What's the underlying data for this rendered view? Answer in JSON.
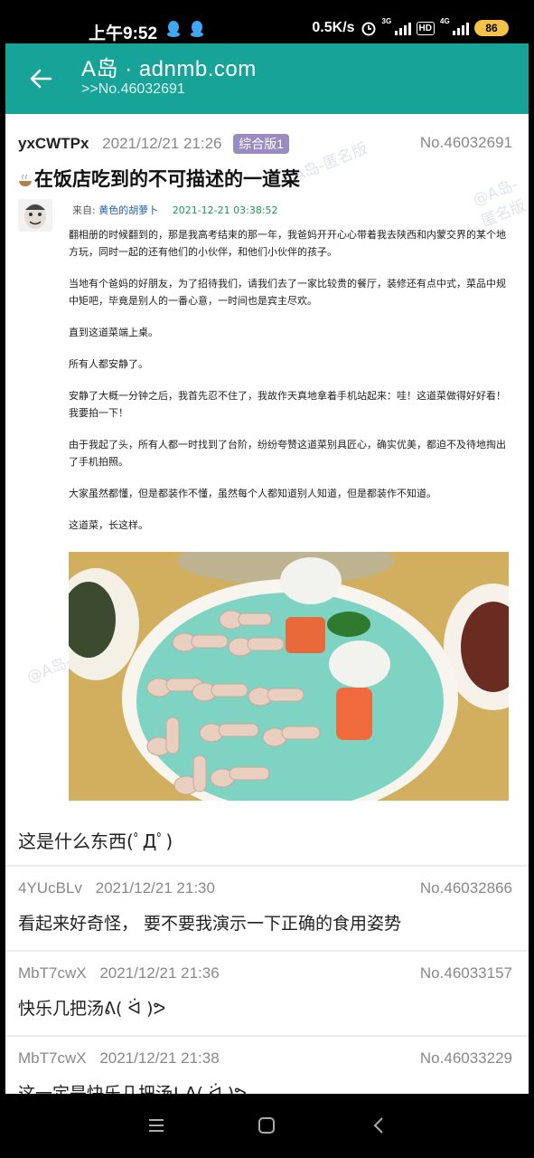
{
  "status": {
    "time": "上午9:52",
    "speed": "0.5K/s",
    "net1": "3G",
    "net2": "4G",
    "hd": "HD",
    "battery": "86"
  },
  "header": {
    "title": "A岛 · adnmb.com",
    "subtitle": ">>No.46032691"
  },
  "thread": {
    "uid": "yxCWTPx",
    "time": "2021/12/21 21:26",
    "tag": "综合版1",
    "no": "No.46032691",
    "title": "在饭店吃到的不可描述的一道菜",
    "watermark": "@A岛-匿名版",
    "meta_from": "来自:",
    "meta_source": "黄色的胡萝卜",
    "meta_date": "2021-12-21 03:38:52",
    "paragraphs": [
      "翻相册的时候翻到的，那是我高考结束的那一年，我爸妈开开心心带着我去陕西和内蒙交界的某个地方玩，同时一起的还有他们的小伙伴，和他们小伙伴的孩子。",
      "当地有个爸妈的好朋友，为了招待我们，请我们去了一家比较贵的餐厅，装修还有点中式，菜品中规中矩吧，毕竟是别人的一番心意，一时间也是宾主尽欢。",
      "直到这道菜端上桌。",
      "所有人都安静了。",
      "安静了大概一分钟之后，我首先忍不住了，我故作天真地拿着手机站起来：哇！这道菜做得好好看！我要拍一下！",
      "由于我起了头，所有人都一时找到了台阶，纷纷夸赞这道菜别具匠心，确实优美，都迫不及待地掏出了手机拍照。",
      "大家虽然都懂，但是都装作不懂，虽然每个人都知道别人知道，但是都装作不知道。",
      "这道菜，长这样。"
    ],
    "reply_text": "这是什么东西(ﾟДﾟ)"
  },
  "replies": [
    {
      "uid": "4YUcBLv",
      "time": "2021/12/21 21:30",
      "no": "No.46032866",
      "text": "看起来好奇怪， 要不要我演示一下正确的食用姿势"
    },
    {
      "uid": "MbT7cwX",
      "time": "2021/12/21 21:36",
      "no": "No.46033157",
      "text": "快乐几把汤ᕕ( ᐛ )ᕗ"
    },
    {
      "uid": "MbT7cwX",
      "time": "2021/12/21 21:38",
      "no": "No.46033229",
      "text": "这一定是快乐几把汤! ᕕ( ᐛ )ᕗ"
    }
  ],
  "colors": {
    "accent": "#17a398",
    "tag": "#9a8bc0",
    "link": "#1e5fa8",
    "date": "#1a9950"
  }
}
